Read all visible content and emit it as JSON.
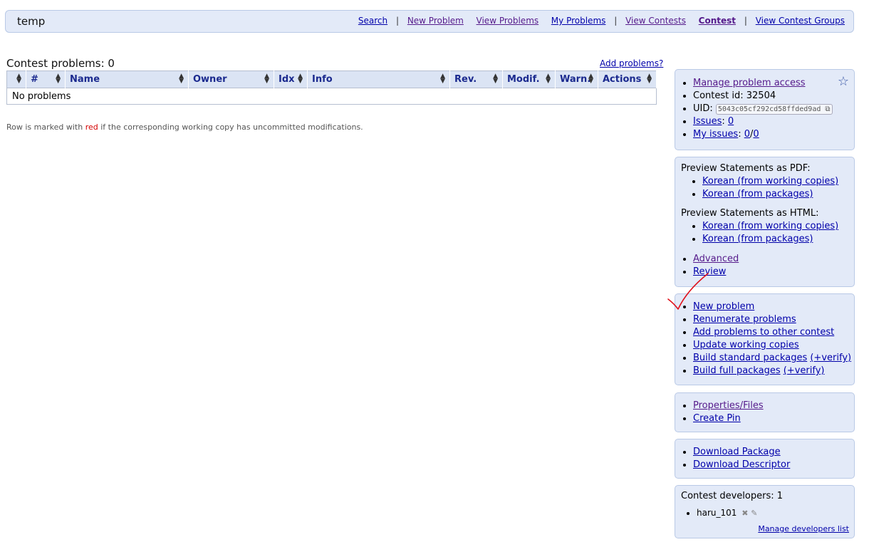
{
  "header": {
    "title": "temp",
    "nav": {
      "search": "Search",
      "new_problem": "New Problem",
      "view_problems": "View Problems",
      "my_problems": "My Problems",
      "view_contests": "View Contests",
      "contest": "Contest",
      "view_contest_groups": "View Contest Groups",
      "sep": "|"
    }
  },
  "main": {
    "title": "Contest problems: 0",
    "add_problems": "Add problems?",
    "columns": [
      "#",
      "Name",
      "Owner",
      "Idx",
      "Info",
      "Rev.",
      "Modif.",
      "Warn.",
      "Actions"
    ],
    "empty_text": "No problems",
    "legend_prefix": "Row is marked with ",
    "legend_red": "red",
    "legend_suffix": " if the corresponding working copy has uncommitted modifications."
  },
  "sidebar": {
    "info": {
      "manage_access": "Manage problem access",
      "contest_id_label": "Contest id: ",
      "contest_id": "32504",
      "uid_label": "UID: ",
      "uid": "5043c05cf292cd58ffded9ad",
      "issues_label": "Issues",
      "issues_count": "0",
      "my_issues_label": "My issues",
      "my_issues_a": "0",
      "my_issues_b": "0"
    },
    "preview": {
      "pdf_caption": "Preview Statements as PDF:",
      "pdf_working": "Korean (from working copies)",
      "pdf_packages": "Korean (from packages)",
      "html_caption": "Preview Statements as HTML:",
      "html_working": "Korean (from working copies)",
      "html_packages": "Korean (from packages)",
      "advanced": "Advanced",
      "review": "Review"
    },
    "actions": {
      "new_problem": "New problem",
      "renumerate": "Renumerate problems",
      "add_to_other": "Add problems to other contest",
      "update_wc": "Update working copies",
      "build_standard": "Build standard packages",
      "build_standard_verify": "(+verify)",
      "build_full": "Build full packages",
      "build_full_verify": "(+verify)"
    },
    "props": {
      "properties": "Properties/Files",
      "create_pin": "Create Pin"
    },
    "downloads": {
      "package": "Download Package",
      "descriptor": "Download Descriptor"
    },
    "developers": {
      "caption": "Contest developers: 1",
      "dev1": "haru_101",
      "manage": "Manage developers list"
    }
  },
  "icons": {
    "star": "star-icon",
    "copy": "copy-icon",
    "remove": "remove-icon",
    "edit": "pencil-icon",
    "sort": "sort-arrows-icon"
  }
}
